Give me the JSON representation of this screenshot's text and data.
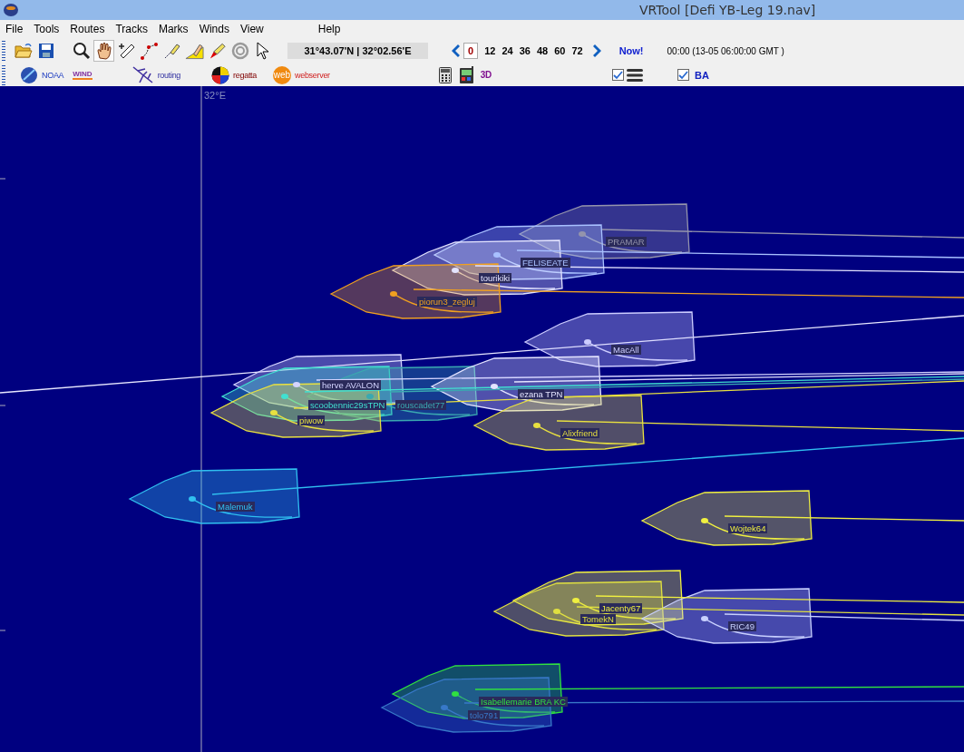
{
  "window": {
    "title": "VRTool [Defi YB-Leg 19.nav]"
  },
  "menu": [
    "File",
    "Tools",
    "Routes",
    "Tracks",
    "Marks",
    "Winds",
    "View",
    "Help"
  ],
  "tools": [
    {
      "kind": "open",
      "selected": false
    },
    {
      "kind": "save",
      "selected": false
    },
    {
      "kind": "zoom",
      "selected": false
    },
    {
      "kind": "hand",
      "selected": true
    },
    {
      "kind": "ruler",
      "selected": false
    },
    {
      "kind": "route",
      "selected": false
    },
    {
      "kind": "pen",
      "selected": false
    },
    {
      "kind": "mark",
      "selected": false
    },
    {
      "kind": "marker",
      "selected": false
    },
    {
      "kind": "target",
      "selected": false
    },
    {
      "kind": "pointer",
      "selected": false
    }
  ],
  "position": "31°43.07'N | 32°02.56'E",
  "time_steps": [
    {
      "label": "0",
      "selected": true
    },
    {
      "label": "12",
      "selected": false
    },
    {
      "label": "24",
      "selected": false
    },
    {
      "label": "36",
      "selected": false
    },
    {
      "label": "48",
      "selected": false
    },
    {
      "label": "60",
      "selected": false
    },
    {
      "label": "72",
      "selected": false
    }
  ],
  "now_button": "Now!",
  "time": "00:00 (13-05 06:00:00 GMT )",
  "toolbar2": {
    "noaa": "NOAA",
    "wind_logo": "WIND",
    "routing": "routing",
    "regatta": "regatta",
    "web_logo": "web",
    "webserver": "webserver",
    "three_d": "3D",
    "checkboxes": [
      {
        "checked": true
      },
      {
        "checked": true,
        "label": "BA"
      }
    ]
  },
  "map": {
    "meridian_label": "32°E",
    "boats": [
      {
        "name": "PRAMAR",
        "color": "#9494ac"
      },
      {
        "name": "FELISEATE",
        "color": "#a8c0ff"
      },
      {
        "name": "tourikiki",
        "color": "#e4e4ff"
      },
      {
        "name": "piorun3_zegluj",
        "color": "#f0a020"
      },
      {
        "name": "MacAll",
        "color": "#ccccff"
      },
      {
        "name": "herve AVALON",
        "color": "#d4d4ff"
      },
      {
        "name": "scoobennic29sTPN",
        "color": "#40e0d0"
      },
      {
        "name": "rouscadet77",
        "color": "#3aa8b0"
      },
      {
        "name": "ezana TPN",
        "color": "#e4e4ff"
      },
      {
        "name": "piwow",
        "color": "#e8e040"
      },
      {
        "name": "Alixfriend",
        "color": "#e8e040"
      },
      {
        "name": "Malemuk",
        "color": "#30c0f0"
      },
      {
        "name": "Wojtek64",
        "color": "#f0f040"
      },
      {
        "name": "Jacenty67",
        "color": "#f0f040"
      },
      {
        "name": "TomekN",
        "color": "#e0e040"
      },
      {
        "name": "RIC49",
        "color": "#c8d0ff"
      },
      {
        "name": "Isabellemarie BRA KC",
        "color": "#30e040"
      },
      {
        "name": "tolo791",
        "color": "#3878c8"
      }
    ]
  }
}
